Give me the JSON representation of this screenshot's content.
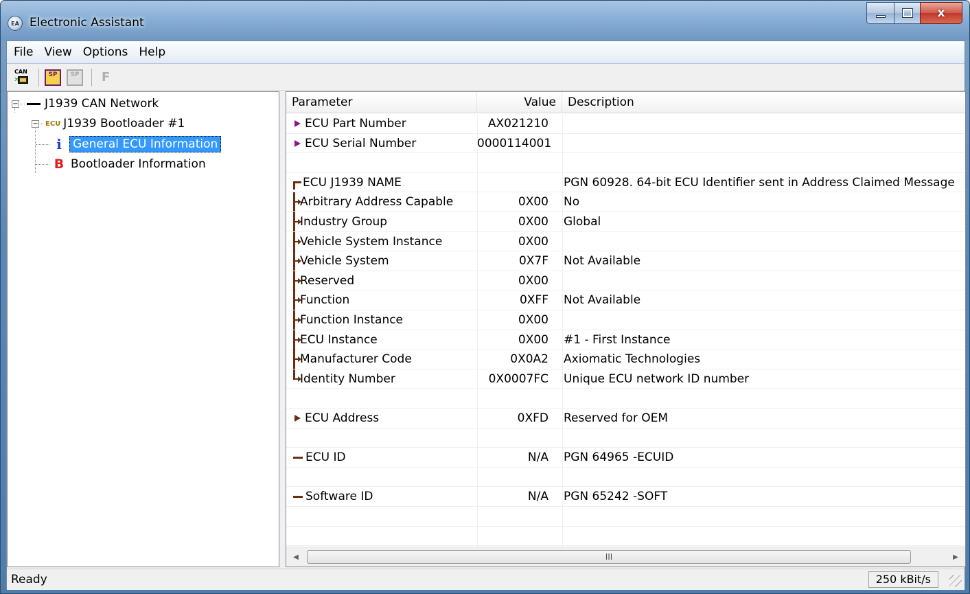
{
  "window": {
    "title": "Electronic Assistant",
    "app_icon_text": "EA",
    "close_glyph": "x"
  },
  "menu": [
    "File",
    "View",
    "Options",
    "Help"
  ],
  "toolbar": {
    "can_icon_label": "CAN",
    "sp_icon_label": "SP",
    "f_label": "F"
  },
  "tree": {
    "network": {
      "expander": "−",
      "label": "J1939 CAN Network"
    },
    "device": {
      "expander": "−",
      "tag": "ECU",
      "label": "J1939 Bootloader #1"
    },
    "general": {
      "icon": "i",
      "label": "General ECU Information"
    },
    "bootloader": {
      "icon": "B",
      "label": "Bootloader Information"
    }
  },
  "grid": {
    "columns": [
      "Parameter",
      "Value",
      "Description"
    ],
    "rows": [
      {
        "marker": "tri-purple",
        "param": "ECU Part Number",
        "value": "AX021210",
        "desc": ""
      },
      {
        "marker": "tri-purple",
        "param": "ECU Serial Number",
        "value": "0000114001",
        "desc": ""
      },
      {
        "marker": "none",
        "param": "",
        "value": "",
        "desc": ""
      },
      {
        "marker": "top",
        "param": "ECU J1939 NAME",
        "value": "",
        "desc": "PGN 60928. 64-bit ECU Identifier sent in Address Claimed Message"
      },
      {
        "marker": "arrow",
        "param": "Arbitrary Address Capable",
        "value": "0X00",
        "desc": "No"
      },
      {
        "marker": "arrow",
        "param": "Industry Group",
        "value": "0X00",
        "desc": "Global"
      },
      {
        "marker": "arrow",
        "param": "Vehicle System Instance",
        "value": "0X00",
        "desc": ""
      },
      {
        "marker": "arrow",
        "param": "Vehicle System",
        "value": "0X7F",
        "desc": "Not Available"
      },
      {
        "marker": "arrow",
        "param": "Reserved",
        "value": "0X00",
        "desc": ""
      },
      {
        "marker": "arrow",
        "param": "Function",
        "value": "0XFF",
        "desc": "Not Available"
      },
      {
        "marker": "arrow",
        "param": "Function Instance",
        "value": "0X00",
        "desc": ""
      },
      {
        "marker": "arrow",
        "param": "ECU Instance",
        "value": "0X00",
        "desc": "#1 - First Instance"
      },
      {
        "marker": "arrow",
        "param": "Manufacturer Code",
        "value": "0X0A2",
        "desc": "Axiomatic Technologies"
      },
      {
        "marker": "last",
        "param": "Identity Number",
        "value": "0X0007FC",
        "desc": "Unique ECU network ID number"
      },
      {
        "marker": "none",
        "param": "",
        "value": "",
        "desc": ""
      },
      {
        "marker": "tri-brown",
        "param": "ECU Address",
        "value": "0XFD",
        "desc": "Reserved for OEM"
      },
      {
        "marker": "none",
        "param": "",
        "value": "",
        "desc": ""
      },
      {
        "marker": "line",
        "param": "ECU ID",
        "value": "N/A",
        "desc": "PGN 64965   -ECUID"
      },
      {
        "marker": "none",
        "param": "",
        "value": "",
        "desc": ""
      },
      {
        "marker": "line",
        "param": "Software ID",
        "value": "N/A",
        "desc": "PGN 65242   -SOFT"
      },
      {
        "marker": "none",
        "param": "",
        "value": "",
        "desc": ""
      },
      {
        "marker": "none",
        "param": "",
        "value": "",
        "desc": ""
      }
    ]
  },
  "scrollbar": {
    "left": "◀",
    "right": "▶",
    "thumb_grip": "III"
  },
  "status": {
    "text": "Ready",
    "rate": "250 kBit/s"
  }
}
